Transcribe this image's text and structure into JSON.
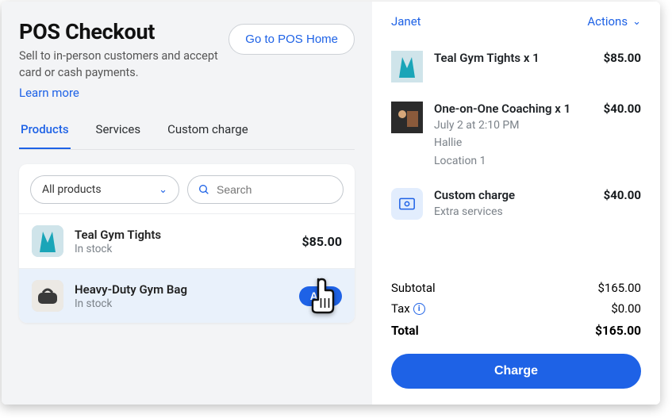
{
  "header": {
    "title": "POS Checkout",
    "subtitle": "Sell to in-person customers and accept card or cash payments.",
    "learn_more": "Learn more",
    "home_button": "Go to POS Home"
  },
  "tabs": {
    "products": "Products",
    "services": "Services",
    "custom": "Custom charge"
  },
  "filter": {
    "dropdown": "All products",
    "search_placeholder": "Search"
  },
  "products": [
    {
      "name": "Teal Gym Tights",
      "stock": "In stock",
      "price": "$85.00"
    },
    {
      "name": "Heavy-Duty Gym Bag",
      "stock": "In stock",
      "add_label": "Add"
    }
  ],
  "cart": {
    "customer": "Janet",
    "actions_label": "Actions",
    "lines": [
      {
        "title": "Teal Gym Tights x 1",
        "price": "$85.00"
      },
      {
        "title": "One-on-One Coaching x 1",
        "sub1": "July 2 at 2:10 PM",
        "sub2": "Hallie",
        "sub3": "Location 1",
        "price": "$40.00"
      },
      {
        "title": "Custom charge",
        "sub1": "Extra services",
        "price": "$40.00"
      }
    ]
  },
  "totals": {
    "subtotal_label": "Subtotal",
    "subtotal_value": "$165.00",
    "tax_label": "Tax",
    "tax_value": "$0.00",
    "total_label": "Total",
    "total_value": "$165.00",
    "charge_button": "Charge"
  }
}
